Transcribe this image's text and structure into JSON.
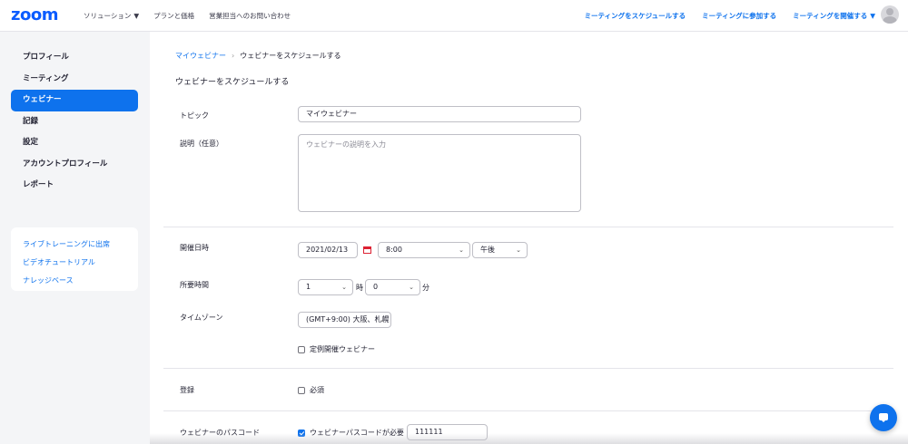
{
  "brand": {
    "logo_text": "zoom",
    "accent": "#0e72ed"
  },
  "topnav": {
    "left": [
      "ソリューション",
      "プランと価格",
      "営業担当へのお問い合わせ"
    ],
    "right": [
      "ミーティングをスケジュールする",
      "ミーティングに参加する",
      "ミーティングを開催する"
    ]
  },
  "sidebar": {
    "items": [
      {
        "label": "プロフィール",
        "active": false
      },
      {
        "label": "ミーティング",
        "active": false
      },
      {
        "label": "ウェビナー",
        "active": true
      },
      {
        "label": "記録",
        "active": false
      },
      {
        "label": "設定",
        "active": false
      },
      {
        "label": "アカウントプロフィール",
        "active": false
      },
      {
        "label": "レポート",
        "active": false
      }
    ],
    "links": [
      "ライブトレーニングに出席",
      "ビデオチュートリアル",
      "ナレッジベース"
    ]
  },
  "breadcrumb": {
    "parent": "マイウェビナー",
    "separator": "›",
    "current": "ウェビナーをスケジュールする"
  },
  "page_title": "ウェビナーをスケジュールする",
  "form": {
    "topic": {
      "label": "トピック",
      "value": "マイウェビナー"
    },
    "description": {
      "label": "説明（任意）",
      "placeholder": "ウェビナーの説明を入力"
    },
    "datetime": {
      "label": "開催日時",
      "date": "2021/02/13",
      "time": "8:00",
      "ampm": "午後"
    },
    "duration": {
      "label": "所要時間",
      "hours": "1",
      "hours_unit": "時",
      "minutes": "0",
      "minutes_unit": "分"
    },
    "timezone": {
      "label": "タイムゾーン",
      "value": "(GMT+9:00) 大阪、札幌"
    },
    "recurring": {
      "label": "定例開催ウェビナー",
      "checked": false
    },
    "registration": {
      "label": "登録",
      "option": "必須",
      "checked": false
    },
    "passcode": {
      "label": "ウェビナーのパスコード",
      "option": "ウェビナーパスコードが必要",
      "checked": true,
      "value": "111111"
    }
  }
}
